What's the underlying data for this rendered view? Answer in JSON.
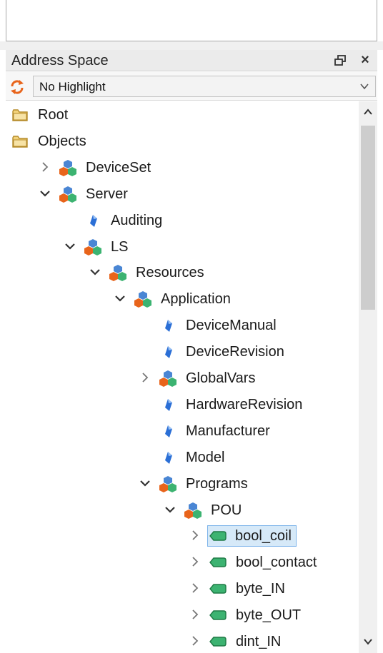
{
  "panel": {
    "title": "Address Space",
    "float_icon": "float-window-icon",
    "close_label": "×"
  },
  "toolbar": {
    "refresh_icon": "refresh-icon",
    "highlight_value": "No Highlight"
  },
  "tree": [
    {
      "id": "root",
      "label": "Root",
      "depth": 0,
      "expander": "none",
      "icon": "folder-icon"
    },
    {
      "id": "objects",
      "label": "Objects",
      "depth": 0,
      "expander": "expanded",
      "icon": "folder-icon"
    },
    {
      "id": "deviceset",
      "label": "DeviceSet",
      "depth": 1,
      "expander": "collapsed",
      "icon": "object-icon"
    },
    {
      "id": "server",
      "label": "Server",
      "depth": 1,
      "expander": "expanded",
      "icon": "object-icon"
    },
    {
      "id": "auditing",
      "label": "Auditing",
      "depth": 2,
      "expander": "none",
      "icon": "property-icon"
    },
    {
      "id": "ls",
      "label": "LS",
      "depth": 2,
      "expander": "expanded",
      "icon": "object-icon"
    },
    {
      "id": "resources",
      "label": "Resources",
      "depth": 3,
      "expander": "expanded",
      "icon": "object-icon"
    },
    {
      "id": "application",
      "label": "Application",
      "depth": 4,
      "expander": "expanded",
      "icon": "object-icon"
    },
    {
      "id": "devicemanual",
      "label": "DeviceManual",
      "depth": 5,
      "expander": "none",
      "icon": "property-icon"
    },
    {
      "id": "devicerevision",
      "label": "DeviceRevision",
      "depth": 5,
      "expander": "none",
      "icon": "property-icon"
    },
    {
      "id": "globalvars",
      "label": "GlobalVars",
      "depth": 5,
      "expander": "collapsed",
      "icon": "object-icon"
    },
    {
      "id": "hardwarerevision",
      "label": "HardwareRevision",
      "depth": 5,
      "expander": "none",
      "icon": "property-icon"
    },
    {
      "id": "manufacturer",
      "label": "Manufacturer",
      "depth": 5,
      "expander": "none",
      "icon": "property-icon"
    },
    {
      "id": "model",
      "label": "Model",
      "depth": 5,
      "expander": "none",
      "icon": "property-icon"
    },
    {
      "id": "programs",
      "label": "Programs",
      "depth": 5,
      "expander": "expanded",
      "icon": "object-icon"
    },
    {
      "id": "pou",
      "label": "POU",
      "depth": 6,
      "expander": "expanded",
      "icon": "object-icon"
    },
    {
      "id": "bool_coil",
      "label": "bool_coil",
      "depth": 7,
      "expander": "collapsed",
      "icon": "variable-icon",
      "selected": true
    },
    {
      "id": "bool_contact",
      "label": "bool_contact",
      "depth": 7,
      "expander": "collapsed",
      "icon": "variable-icon"
    },
    {
      "id": "byte_in",
      "label": "byte_IN",
      "depth": 7,
      "expander": "collapsed",
      "icon": "variable-icon"
    },
    {
      "id": "byte_out",
      "label": "byte_OUT",
      "depth": 7,
      "expander": "collapsed",
      "icon": "variable-icon"
    },
    {
      "id": "dint_in",
      "label": "dint_IN",
      "depth": 7,
      "expander": "collapsed",
      "icon": "variable-icon"
    }
  ],
  "colors": {
    "selection_bg": "#d6e9f8",
    "selection_border": "#7eb4ea",
    "refresh_orange": "#e8641b",
    "folder_yellow": "#f2d27a",
    "variable_green": "#3cb371",
    "property_blue": "#2b6fd6"
  }
}
